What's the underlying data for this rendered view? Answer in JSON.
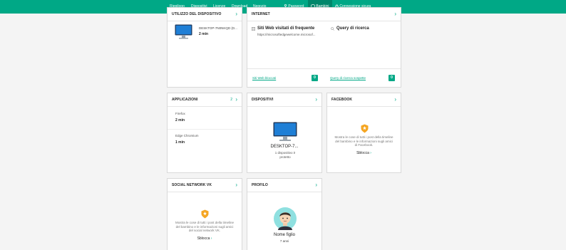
{
  "nav": {
    "items": [
      {
        "label": "Riepilogo"
      },
      {
        "label": "Dispositivi"
      },
      {
        "label": "Licenze"
      },
      {
        "label": "Download"
      },
      {
        "label": "Negozio"
      },
      {
        "label": "Password",
        "icon": "key-icon"
      },
      {
        "label": "Bambini",
        "icon": "shield-icon",
        "active": true
      },
      {
        "label": "Connessione sicura",
        "icon": "lock-icon"
      }
    ]
  },
  "device_usage": {
    "title": "UTILIZZO DEL DISPOSITIVO",
    "device_name": "DESKTOP-7N0NKQD (D...",
    "time": "2 min"
  },
  "internet": {
    "title": "INTERNET",
    "visited_sites_title": "Siti Web visitati di frequente",
    "visited_site_url": "https://microsoftedgewelcome.microsof...",
    "search_queries_title": "Query di ricerca",
    "blocked_sites_label": "Siti Web bloccati",
    "blocked_sites_count": "0",
    "suspicious_queries_label": "Query di ricerca sospette",
    "suspicious_queries_count": "0"
  },
  "apps": {
    "title": "APPLICAZIONI",
    "count": "2",
    "items": [
      {
        "name": "Firefox",
        "time": "2 min"
      },
      {
        "name": "Edge Chromium",
        "time": "1 min"
      }
    ]
  },
  "devices": {
    "title": "DISPOSITIVI",
    "device_name": "DESKTOP-7...",
    "protected_text": "1 dispositivo è protetto"
  },
  "facebook": {
    "title": "FACEBOOK",
    "description": "Mostra le cose di tutti i post della timeline del bambino e le informazioni sugli amici di Facebook.",
    "action": "Sblocca"
  },
  "vk": {
    "title": "SOCIAL NETWORK VK",
    "description": "Mostra le cose di tutti i post della timeline del bambino e le informazioni sugli amici del social network VK.",
    "action": "Sblocca"
  },
  "profile": {
    "title": "PROFILO",
    "name": "Nome figlio",
    "age": "7 anni"
  },
  "colors": {
    "accent": "#00a886",
    "accent_dark": "#00876b",
    "badge": "#f5a623"
  }
}
